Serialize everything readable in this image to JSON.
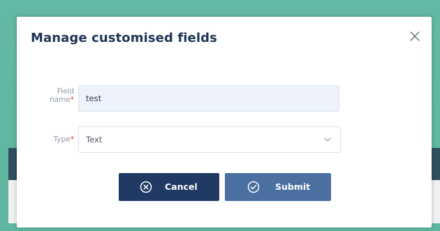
{
  "modal": {
    "title": "Manage customised fields",
    "close_icon": "close-icon"
  },
  "form": {
    "field_name": {
      "label_line1": "Field",
      "label_line2": "name",
      "required_mark": "*",
      "value": "test"
    },
    "type": {
      "label": "Type",
      "required_mark": "*",
      "value": "Text",
      "icon": "chevron-down-icon"
    }
  },
  "buttons": {
    "cancel": {
      "label": "Cancel",
      "icon": "circle-x-icon",
      "color": "#203a64"
    },
    "submit": {
      "label": "Submit",
      "icon": "circle-check-icon",
      "color": "#4a6fa0"
    }
  },
  "colors": {
    "title": "#1e3555",
    "required": "#d23c3c",
    "backdrop": "#5fb8a2"
  }
}
